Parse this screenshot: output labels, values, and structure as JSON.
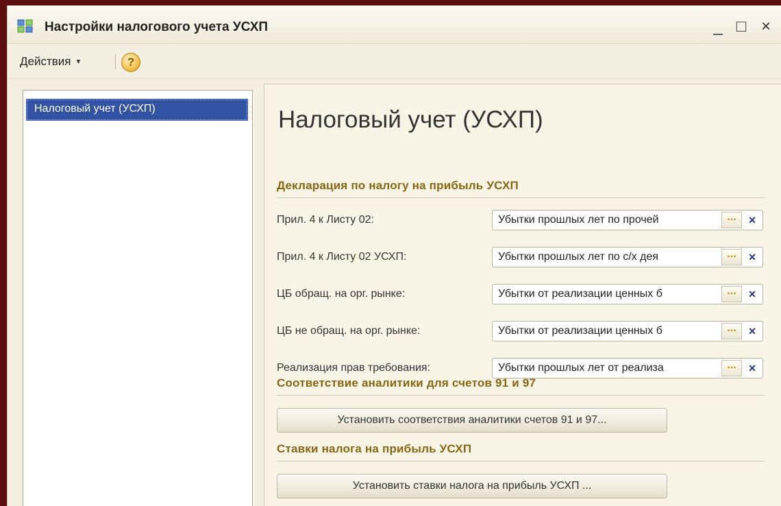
{
  "window": {
    "title": "Настройки налогового учета УСХП",
    "minimize": "_",
    "maximize": "□",
    "close": "×"
  },
  "toolbar": {
    "actions_label": "Действия",
    "help_label": "?"
  },
  "sidebar": {
    "items": [
      {
        "label": "Налоговый учет (УСХП)",
        "selected": true
      }
    ]
  },
  "main": {
    "title": "Налоговый учет (УСХП)",
    "sections": [
      {
        "title": "Декларация по налогу на прибыль УСХП"
      },
      {
        "title": "Соответствие аналитики для счетов 91 и 97"
      },
      {
        "title": "Ставки налога на прибыль УСХП"
      }
    ],
    "fields": [
      {
        "label": "Прил. 4 к Листу 02:",
        "value": "Убытки прошлых лет по прочей"
      },
      {
        "label": "Прил. 4 к Листу 02 УСХП:",
        "value": "Убытки прошлых лет по с/х дея"
      },
      {
        "label": "ЦБ обращ. на орг. рынке:",
        "value": "Убытки от реализации ценных б"
      },
      {
        "label": "ЦБ не обращ. на орг. рынке:",
        "value": "Убытки от реализации ценных б"
      },
      {
        "label": "Реализация прав требования:",
        "value": "Убытки прошлых лет от реализа"
      }
    ],
    "field_select_label": "...",
    "field_clear_label": "×",
    "buttons": {
      "analytics": "Установить соответствия аналитики счетов 91 и 97...",
      "rates": "Установить ставки налога на прибыль УСХП ..."
    }
  },
  "colors": {
    "selection": "#3253a4",
    "section_title": "#8a6512",
    "window_bg": "#f3f0e3",
    "frame": "#5a0e0e"
  }
}
